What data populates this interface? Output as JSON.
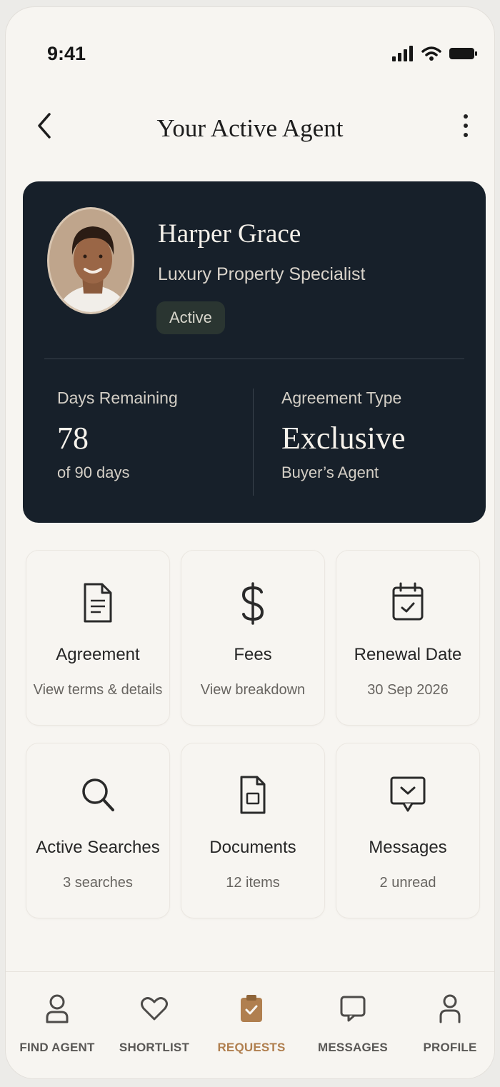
{
  "status_bar": {
    "time": "9:41"
  },
  "header": {
    "title": "Your Active Agent"
  },
  "agent": {
    "name": "Harper Grace",
    "role": "Luxury Property Specialist",
    "status": "Active",
    "days_label": "Days Remaining",
    "days_value": "78",
    "days_sub": "of 90 days",
    "agreement_label": "Agreement Type",
    "agreement_value": "Exclusive",
    "agreement_sub": "Buyer’s Agent"
  },
  "tiles": [
    {
      "icon": "document-icon",
      "title": "Agreement",
      "subtitle": "View terms & details"
    },
    {
      "icon": "dollar-icon",
      "title": "Fees",
      "subtitle": "View breakdown"
    },
    {
      "icon": "calendar-icon",
      "title": "Renewal Date",
      "subtitle": "30 Sep 2026"
    },
    {
      "icon": "search-icon",
      "title": "Active Searches",
      "subtitle": "3 searches"
    },
    {
      "icon": "file-icon",
      "title": "Documents",
      "subtitle": "12 items"
    },
    {
      "icon": "message-icon",
      "title": "Messages",
      "subtitle": "2 unread"
    }
  ],
  "nav": [
    {
      "icon": "person-icon",
      "label": "FIND AGENT",
      "active": false
    },
    {
      "icon": "heart-icon",
      "label": "SHORTLIST",
      "active": false
    },
    {
      "icon": "clipboard-icon",
      "label": "REQUESTS",
      "active": true
    },
    {
      "icon": "chat-icon",
      "label": "MESSAGES",
      "active": false
    },
    {
      "icon": "profile-icon",
      "label": "PROFILE",
      "active": false
    }
  ],
  "colors": {
    "card_bg": "#17202a",
    "accent": "#b07f4f",
    "page_bg": "#f7f5f1"
  }
}
